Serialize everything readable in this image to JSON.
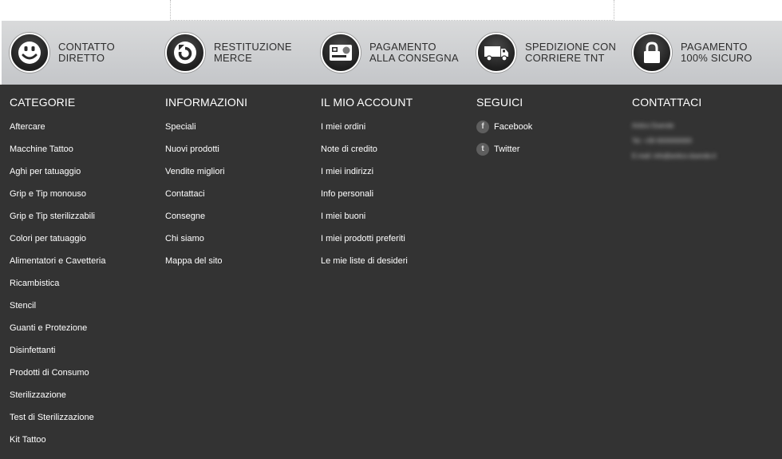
{
  "features": [
    {
      "icon": "smiley-icon",
      "line1": "CONTATTO",
      "line2": "DIRETTO"
    },
    {
      "icon": "return-arrow-icon",
      "line1": "RESTITUZIONE",
      "line2": "MERCE"
    },
    {
      "icon": "credit-card-icon",
      "line1": "PAGAMENTO",
      "line2": "ALLA CONSEGNA"
    },
    {
      "icon": "truck-icon",
      "line1": "SPEDIZIONE CON",
      "line2": "CORRIERE TNT"
    },
    {
      "icon": "padlock-icon",
      "line1": "PAGAMENTO",
      "line2": "100% SICURO"
    }
  ],
  "categorie": {
    "title": "CATEGORIE",
    "items": [
      "Aftercare",
      "Macchine Tattoo",
      "Aghi per tatuaggio",
      "Grip e Tip monouso",
      "Grip e Tip sterilizzabili",
      "Colori per tatuaggio",
      "Alimentatori e Cavetteria",
      "Ricambistica",
      "Stencil",
      "Guanti e Protezione",
      "Disinfettanti",
      "Prodotti di Consumo",
      "Sterilizzazione",
      "Test di Sterilizzazione",
      "Kit Tattoo"
    ]
  },
  "informazioni": {
    "title": "INFORMAZIONI",
    "items": [
      "Speciali",
      "Nuovi prodotti",
      "Vendite migliori",
      "Contattaci",
      "Consegne",
      "Chi siamo",
      "Mappa del sito"
    ]
  },
  "account": {
    "title": "IL MIO ACCOUNT",
    "items": [
      "I miei ordini",
      "Note di credito",
      "I miei indirizzi",
      "Info personali",
      "I miei buoni",
      "I miei prodotti preferiti",
      "Le mie liste di desideri"
    ]
  },
  "seguici": {
    "title": "SEGUICI",
    "facebook": {
      "glyph": "f",
      "label": "Facebook",
      "icon": "facebook-icon"
    },
    "twitter": {
      "glyph": "t",
      "label": "Twitter",
      "icon": "twitter-icon"
    }
  },
  "contattaci": {
    "title": "CONTATTACI",
    "company": "Antico Duende",
    "phone": "Tel. +39 0000000000",
    "email": "E-mail: info@antico-duende.it"
  }
}
